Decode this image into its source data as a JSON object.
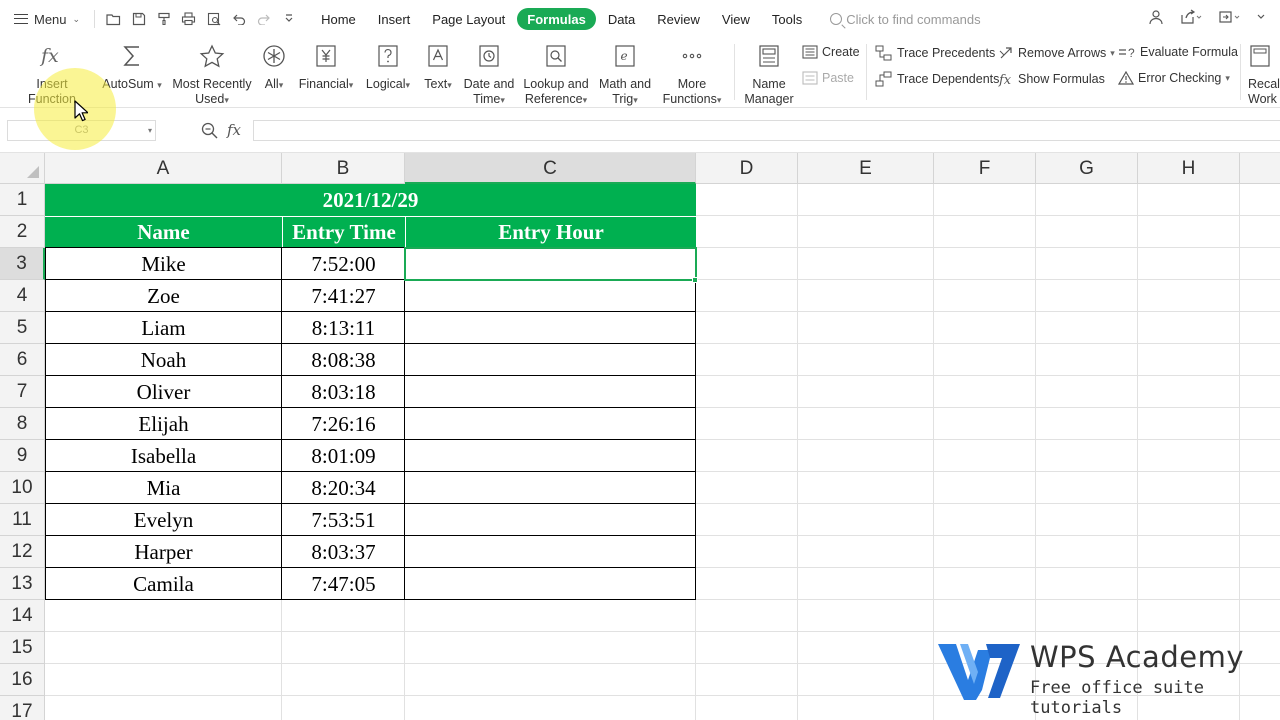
{
  "menubar": {
    "menu_label": "Menu",
    "tabs": [
      "Home",
      "Insert",
      "Page Layout",
      "Formulas",
      "Data",
      "Review",
      "View",
      "Tools"
    ],
    "active_tab": "Formulas",
    "search_placeholder": "Click to find commands"
  },
  "ribbon": {
    "insert_function": "Insert Function",
    "autosum": "AutoSum",
    "most_recently_used": [
      "Most Recently",
      "Used"
    ],
    "all": "All",
    "financial": "Financial",
    "logical": "Logical",
    "text": "Text",
    "date_time": [
      "Date and",
      "Time"
    ],
    "lookup_ref": [
      "Lookup and",
      "Reference"
    ],
    "math_trig": [
      "Math and",
      "Trig"
    ],
    "more_functions": [
      "More",
      "Functions"
    ],
    "name_manager": [
      "Name",
      "Manager"
    ],
    "create": "Create",
    "paste": "Paste",
    "trace_precedents": "Trace Precedents",
    "trace_dependents": "Trace Dependents",
    "remove_arrows": "Remove Arrows",
    "show_formulas": "Show Formulas",
    "evaluate_formula": "Evaluate Formula",
    "error_checking": "Error Checking",
    "recalc": [
      "Recalc",
      "Work"
    ]
  },
  "formula_bar": {
    "name_box": "C3",
    "fx": "fx",
    "content": ""
  },
  "sheet": {
    "columns": [
      "A",
      "B",
      "C",
      "D",
      "E",
      "F",
      "G",
      "H"
    ],
    "rows": [
      "1",
      "2",
      "3",
      "4",
      "5",
      "6",
      "7",
      "8",
      "9",
      "10",
      "11",
      "12",
      "13",
      "14",
      "15",
      "16",
      "17"
    ],
    "selected_column": "C",
    "selected_row": "3",
    "title": "2021/12/29",
    "headers": [
      "Name",
      "Entry Time",
      "Entry Hour"
    ],
    "data": [
      [
        "Mike",
        "7:52:00"
      ],
      [
        "Zoe",
        "7:41:27"
      ],
      [
        "Liam",
        "8:13:11"
      ],
      [
        "Noah",
        "8:08:38"
      ],
      [
        "Oliver",
        "8:03:18"
      ],
      [
        "Elijah",
        "7:26:16"
      ],
      [
        "Isabella",
        "8:01:09"
      ],
      [
        "Mia",
        "8:20:34"
      ],
      [
        "Evelyn",
        "7:53:51"
      ],
      [
        "Harper",
        "8:03:37"
      ],
      [
        "Camila",
        "7:47:05"
      ]
    ]
  },
  "watermark": {
    "title": "WPS Academy",
    "subtitle": "Free office suite tutorials"
  },
  "colors": {
    "accent": "#1aaa55",
    "header_fill": "#00b050"
  }
}
